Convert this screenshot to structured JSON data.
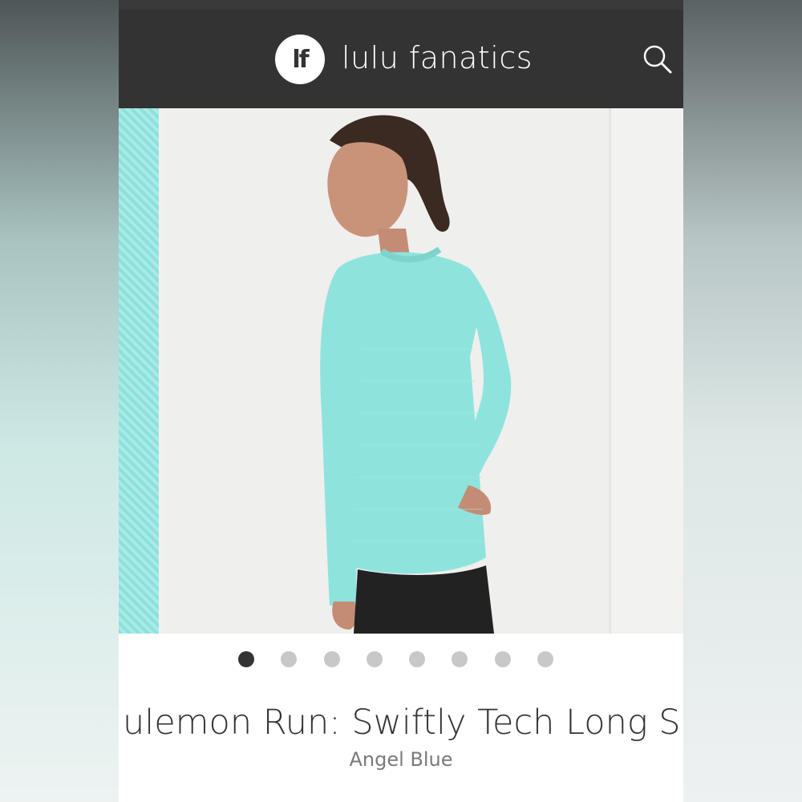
{
  "header": {
    "logo_text": "lf",
    "brand": "lulu fanatics"
  },
  "gallery": {
    "slide_count": 8,
    "active_index": 0
  },
  "product": {
    "title": "ulemon Run: Swiftly Tech Long Slee",
    "color": "Angel Blue"
  },
  "colors": {
    "header_bg": "#333333",
    "shirt": "#8fe3dd",
    "dot_active": "#333333",
    "dot_inactive": "#c8c8c8"
  },
  "icons": {
    "search": "search-icon",
    "logo": "lf-logo"
  }
}
